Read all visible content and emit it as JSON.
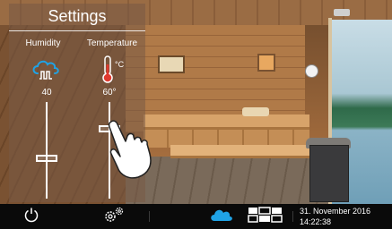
{
  "settings_panel": {
    "title": "Settings",
    "humidity": {
      "label": "Humidity",
      "icon": "humidity-cloud-icon",
      "value": "40",
      "level": 0.45
    },
    "temperature": {
      "label": "Temperature",
      "icon": "thermometer-icon",
      "unit": "°C",
      "value": "60°",
      "level": 0.75
    }
  },
  "bottom_bar": {
    "items": [
      {
        "icon": "power-icon"
      },
      {
        "icon": "settings-gears-icon"
      },
      {
        "icon": "cloud-icon",
        "active": true,
        "color": "#1fa3e6"
      },
      {
        "icon": "grid-layout-icon"
      }
    ],
    "date": "31. November 2016",
    "time": "14:22:38"
  },
  "colors": {
    "accent": "#1fa3e6",
    "thermometer_red": "#e03a2f",
    "bar_background": "#0a0a0a"
  }
}
